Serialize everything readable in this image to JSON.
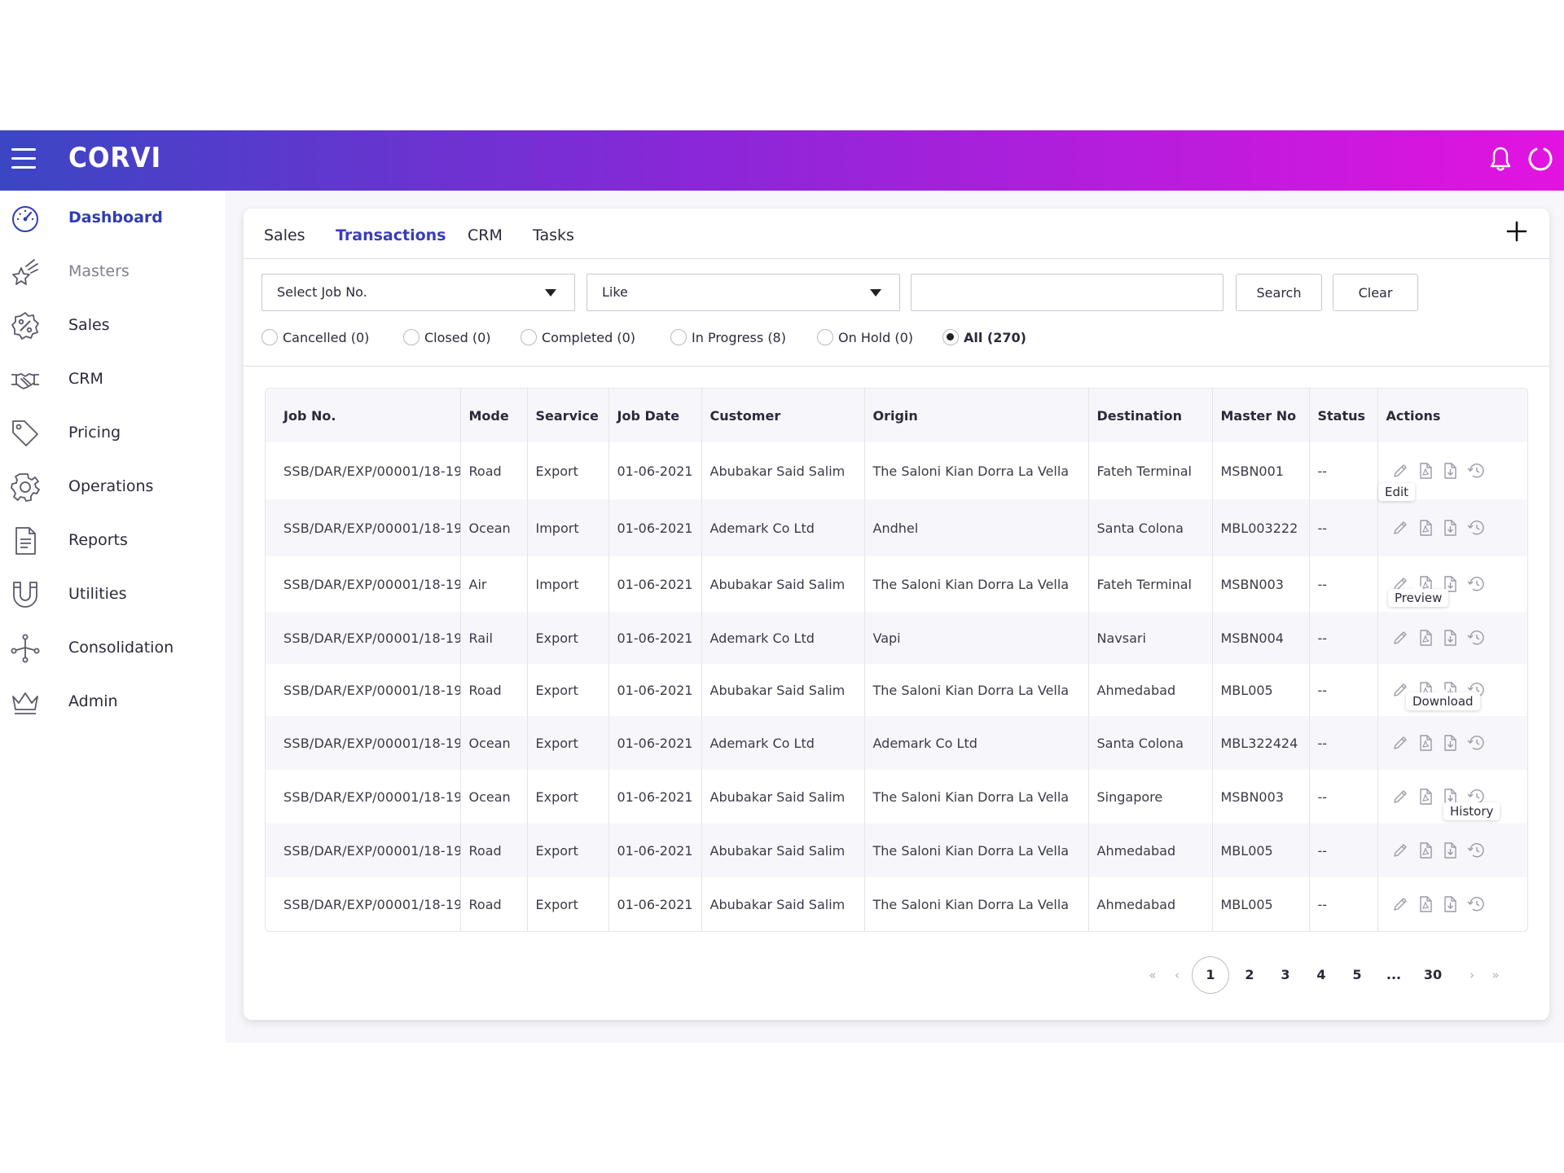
{
  "app": {
    "brand": "CORVI"
  },
  "icons": {
    "menu": "hamburger-menu-icon",
    "bell": "bell-icon",
    "power": "power-icon",
    "add": "plus-icon"
  },
  "colors": {
    "accent": "#3b3db8",
    "gradient_start": "#3b46c4",
    "gradient_end": "#e313e0"
  },
  "sidebar": {
    "items": [
      {
        "label": "Dashboard",
        "icon": "speedometer-icon"
      },
      {
        "label": "Masters",
        "icon": "star-icon"
      },
      {
        "label": "Sales",
        "icon": "percent-badge-icon"
      },
      {
        "label": "CRM",
        "icon": "handshake-icon"
      },
      {
        "label": "Pricing",
        "icon": "tag-icon"
      },
      {
        "label": "Operations",
        "icon": "gear-icon"
      },
      {
        "label": "Reports",
        "icon": "document-icon"
      },
      {
        "label": "Utilities",
        "icon": "magnet-icon"
      },
      {
        "label": "Consolidation",
        "icon": "network-icon"
      },
      {
        "label": "Admin",
        "icon": "crown-icon"
      }
    ]
  },
  "tabs": [
    "Sales",
    "Transactions",
    "CRM",
    "Tasks"
  ],
  "filters": {
    "field_select": "Select Job No.",
    "operator_select": "Like",
    "search_value": "",
    "search_label": "Search",
    "clear_label": "Clear"
  },
  "status_filters": [
    {
      "label": "Cancelled (0)"
    },
    {
      "label": "Closed (0)"
    },
    {
      "label": "Completed (0)"
    },
    {
      "label": "In Progress (8)"
    },
    {
      "label": "On Hold (0)"
    },
    {
      "label": "All (270)",
      "selected": true
    }
  ],
  "table": {
    "headers": [
      "Job No.",
      "Mode",
      "Searvice",
      "Job Date",
      "Customer",
      "Origin",
      "Destination",
      "Master No",
      "Status",
      "Actions"
    ],
    "rows": [
      [
        "SSB/DAR/EXP/00001/18-19",
        "Road",
        "Export",
        "01-06-2021",
        "Abubakar Said Salim",
        "The Saloni Kian Dorra La Vella",
        "Fateh Terminal",
        "MSBN001",
        "--"
      ],
      [
        "SSB/DAR/EXP/00001/18-19",
        "Ocean",
        "Import",
        "01-06-2021",
        "Ademark Co Ltd",
        "Andhel",
        "Santa Colona",
        "MBL003222",
        "--"
      ],
      [
        "SSB/DAR/EXP/00001/18-19",
        "Air",
        "Import",
        "01-06-2021",
        "Abubakar Said Salim",
        "The Saloni Kian Dorra La Vella",
        "Fateh Terminal",
        "MSBN003",
        "--"
      ],
      [
        "SSB/DAR/EXP/00001/18-19",
        "Rail",
        "Export",
        "01-06-2021",
        "Ademark Co Ltd",
        "Vapi",
        "Navsari",
        "MSBN004",
        "--"
      ],
      [
        "SSB/DAR/EXP/00001/18-19",
        "Road",
        "Export",
        "01-06-2021",
        "Abubakar Said Salim",
        "The Saloni Kian Dorra La Vella",
        "Ahmedabad",
        "MBL005",
        "--"
      ],
      [
        "SSB/DAR/EXP/00001/18-19",
        "Ocean",
        "Export",
        "01-06-2021",
        "Ademark Co Ltd",
        "Ademark Co Ltd",
        "Santa Colona",
        "MBL322424",
        "--"
      ],
      [
        "SSB/DAR/EXP/00001/18-19",
        "Ocean",
        "Export",
        "01-06-2021",
        "Abubakar Said Salim",
        "The Saloni Kian Dorra La Vella",
        "Singapore",
        "MSBN003",
        "--"
      ],
      [
        "SSB/DAR/EXP/00001/18-19",
        "Road",
        "Export",
        "01-06-2021",
        "Abubakar Said Salim",
        "The Saloni Kian Dorra La Vella",
        "Ahmedabad",
        "MBL005",
        "--"
      ],
      [
        "SSB/DAR/EXP/00001/18-19",
        "Road",
        "Export",
        "01-06-2021",
        "Abubakar Said Salim",
        "The Saloni Kian Dorra La Vella",
        "Ahmedabad",
        "MBL005",
        "--"
      ]
    ],
    "action_icons": [
      "pencil-icon",
      "pdf-icon",
      "download-file-icon",
      "history-icon"
    ]
  },
  "tooltips": {
    "edit": "Edit",
    "preview": "Preview",
    "download": "Download",
    "history": "History"
  },
  "pagination": {
    "first": "«",
    "prev": "‹",
    "pages": [
      "1",
      "2",
      "3",
      "4",
      "5",
      "...",
      "30"
    ],
    "current": "1",
    "next": "›",
    "last": "»"
  }
}
